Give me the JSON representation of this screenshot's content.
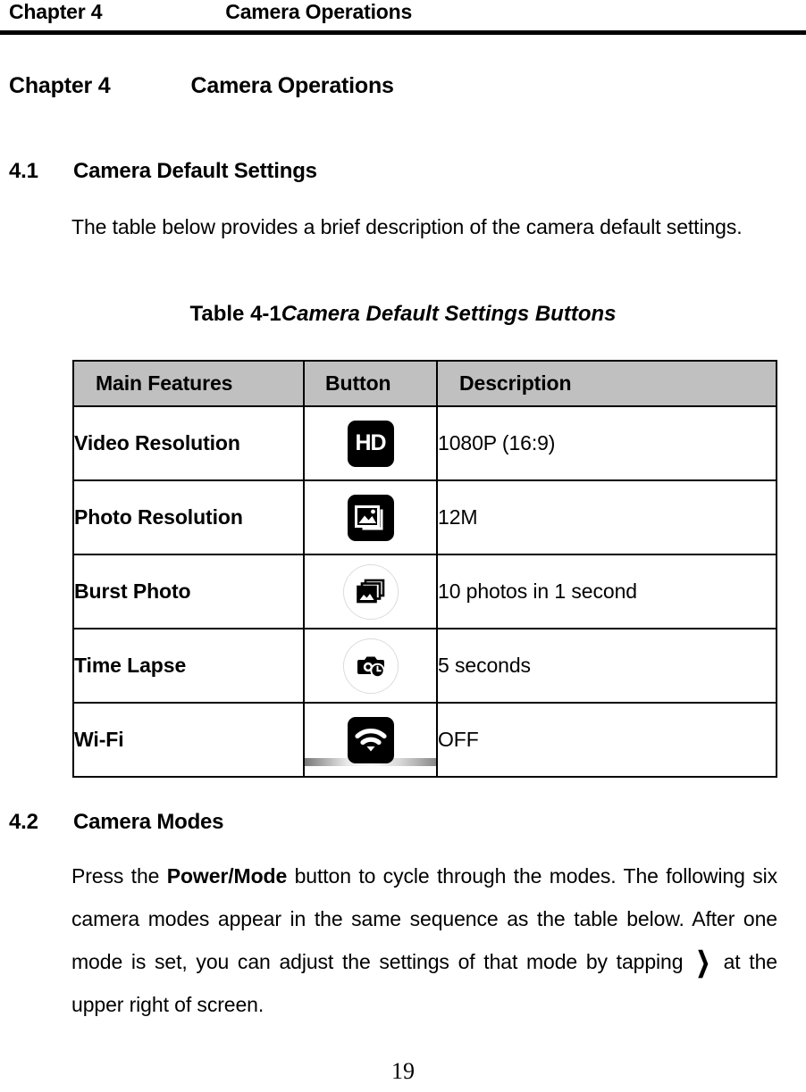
{
  "running_header": {
    "chapter": "Chapter 4",
    "title": "Camera Operations"
  },
  "chapter_title": {
    "number": "Chapter 4",
    "name": "Camera Operations"
  },
  "sections": {
    "s41": {
      "number": "4.1",
      "title": "Camera Default Settings",
      "paragraph": "The table below provides a brief description of the camera default settings."
    },
    "s42": {
      "number": "4.2",
      "title": "Camera Modes",
      "para_part1": "Press the ",
      "para_bold": "Power/Mode",
      "para_part2": " button to cycle through the modes. The following six camera modes appear in the same sequence as the table below. After one mode is set, you can adjust the settings of that mode by tapping ",
      "chevron_icon": "chevron-right-icon",
      "chevron_glyph": "❯",
      "para_part3": " at the upper right of screen."
    }
  },
  "table_caption": {
    "number": "Table 4-1",
    "text": "Camera Default Settings Buttons"
  },
  "table": {
    "header": [
      "Main Features",
      "Button",
      "Description"
    ],
    "header_bg": "#c0c0c0",
    "rows": [
      {
        "feature": "Video Resolution",
        "icon": "hd-badge-icon",
        "icon_label": "HD",
        "description": "1080P (16:9)"
      },
      {
        "feature": "Photo Resolution",
        "icon": "photo-resolution-icon",
        "icon_label": "",
        "description": "12M"
      },
      {
        "feature": "Burst Photo",
        "icon": "burst-photo-icon",
        "icon_label": "",
        "description": "10 photos in 1 second"
      },
      {
        "feature": "Time Lapse",
        "icon": "time-lapse-icon",
        "icon_label": "",
        "description": "5 seconds"
      },
      {
        "feature": "Wi-Fi",
        "icon": "wifi-icon",
        "icon_label": "",
        "description": "OFF"
      }
    ]
  },
  "page_number": "19"
}
